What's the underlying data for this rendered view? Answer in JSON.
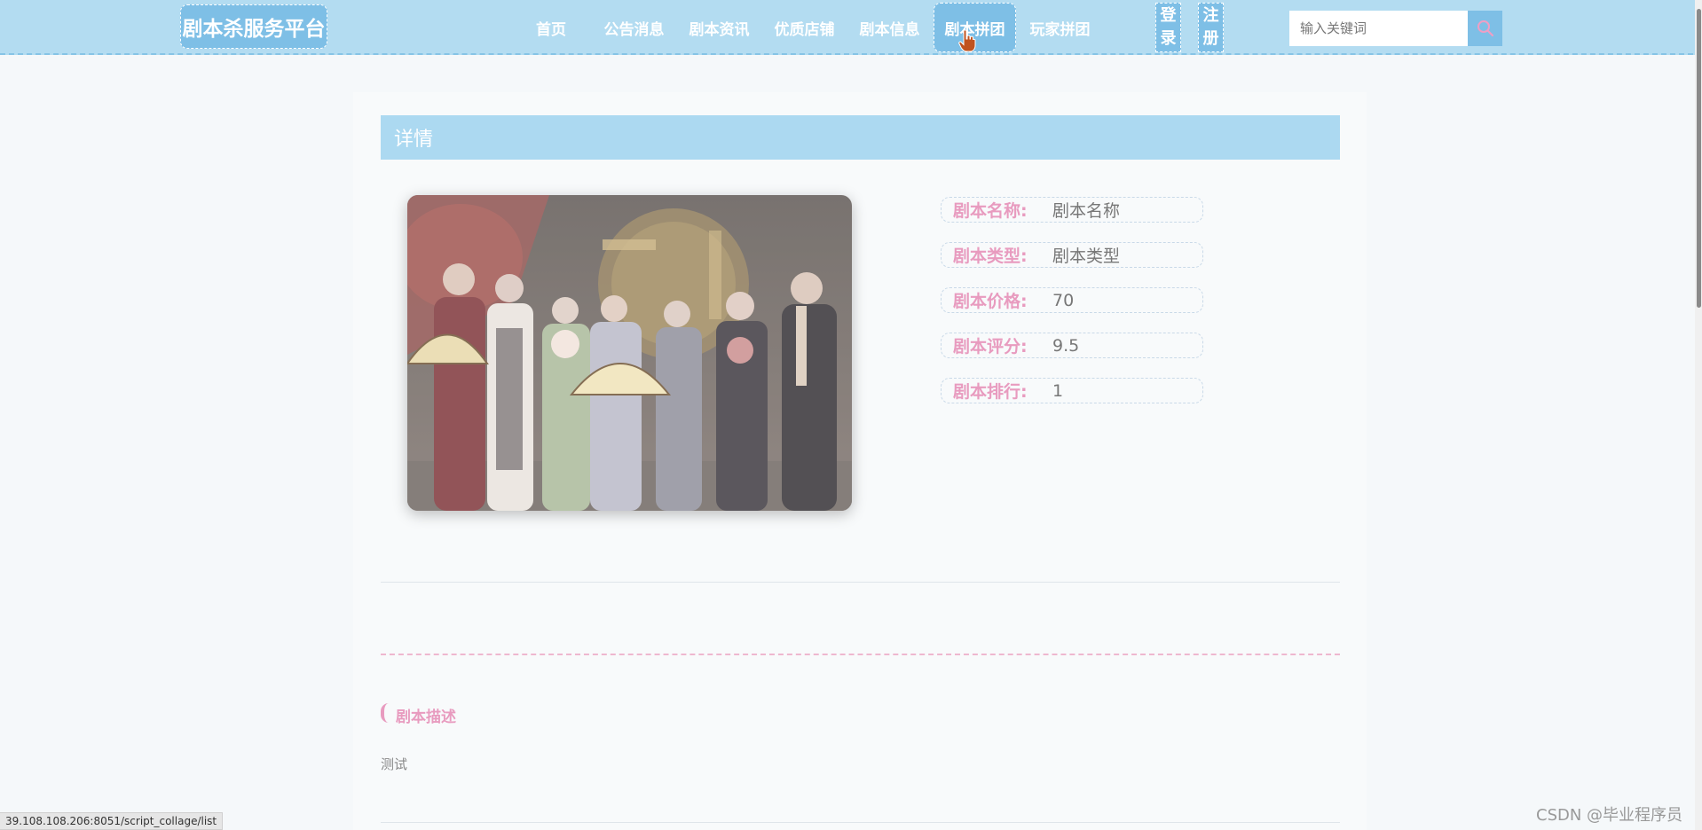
{
  "header": {
    "logo": "剧本杀服务平台",
    "nav": [
      "首页",
      "公告消息",
      "剧本资讯",
      "优质店铺",
      "剧本信息",
      "剧本拼团",
      "玩家拼团"
    ],
    "active_nav": "剧本拼团",
    "login": "登录",
    "register": "注册",
    "search_placeholder": "输入关键词",
    "search_icon": "search-icon",
    "accent_color": "#7ebfe6"
  },
  "detail": {
    "title": "详情",
    "image_alt": "剧本封面",
    "fields": [
      {
        "label": "剧本名称:",
        "value": "剧本名称"
      },
      {
        "label": "剧本类型:",
        "value": "剧本类型"
      },
      {
        "label": "剧本价格:",
        "value": "70"
      },
      {
        "label": "剧本评分:",
        "value": "9.5"
      },
      {
        "label": "剧本排行:",
        "value": "1"
      }
    ]
  },
  "description": {
    "title": "剧本描述",
    "body": "测试"
  },
  "status_bar": {
    "url": "39.108.108.206:8051/script_collage/list"
  },
  "watermark": "CSDN @毕业程序员"
}
